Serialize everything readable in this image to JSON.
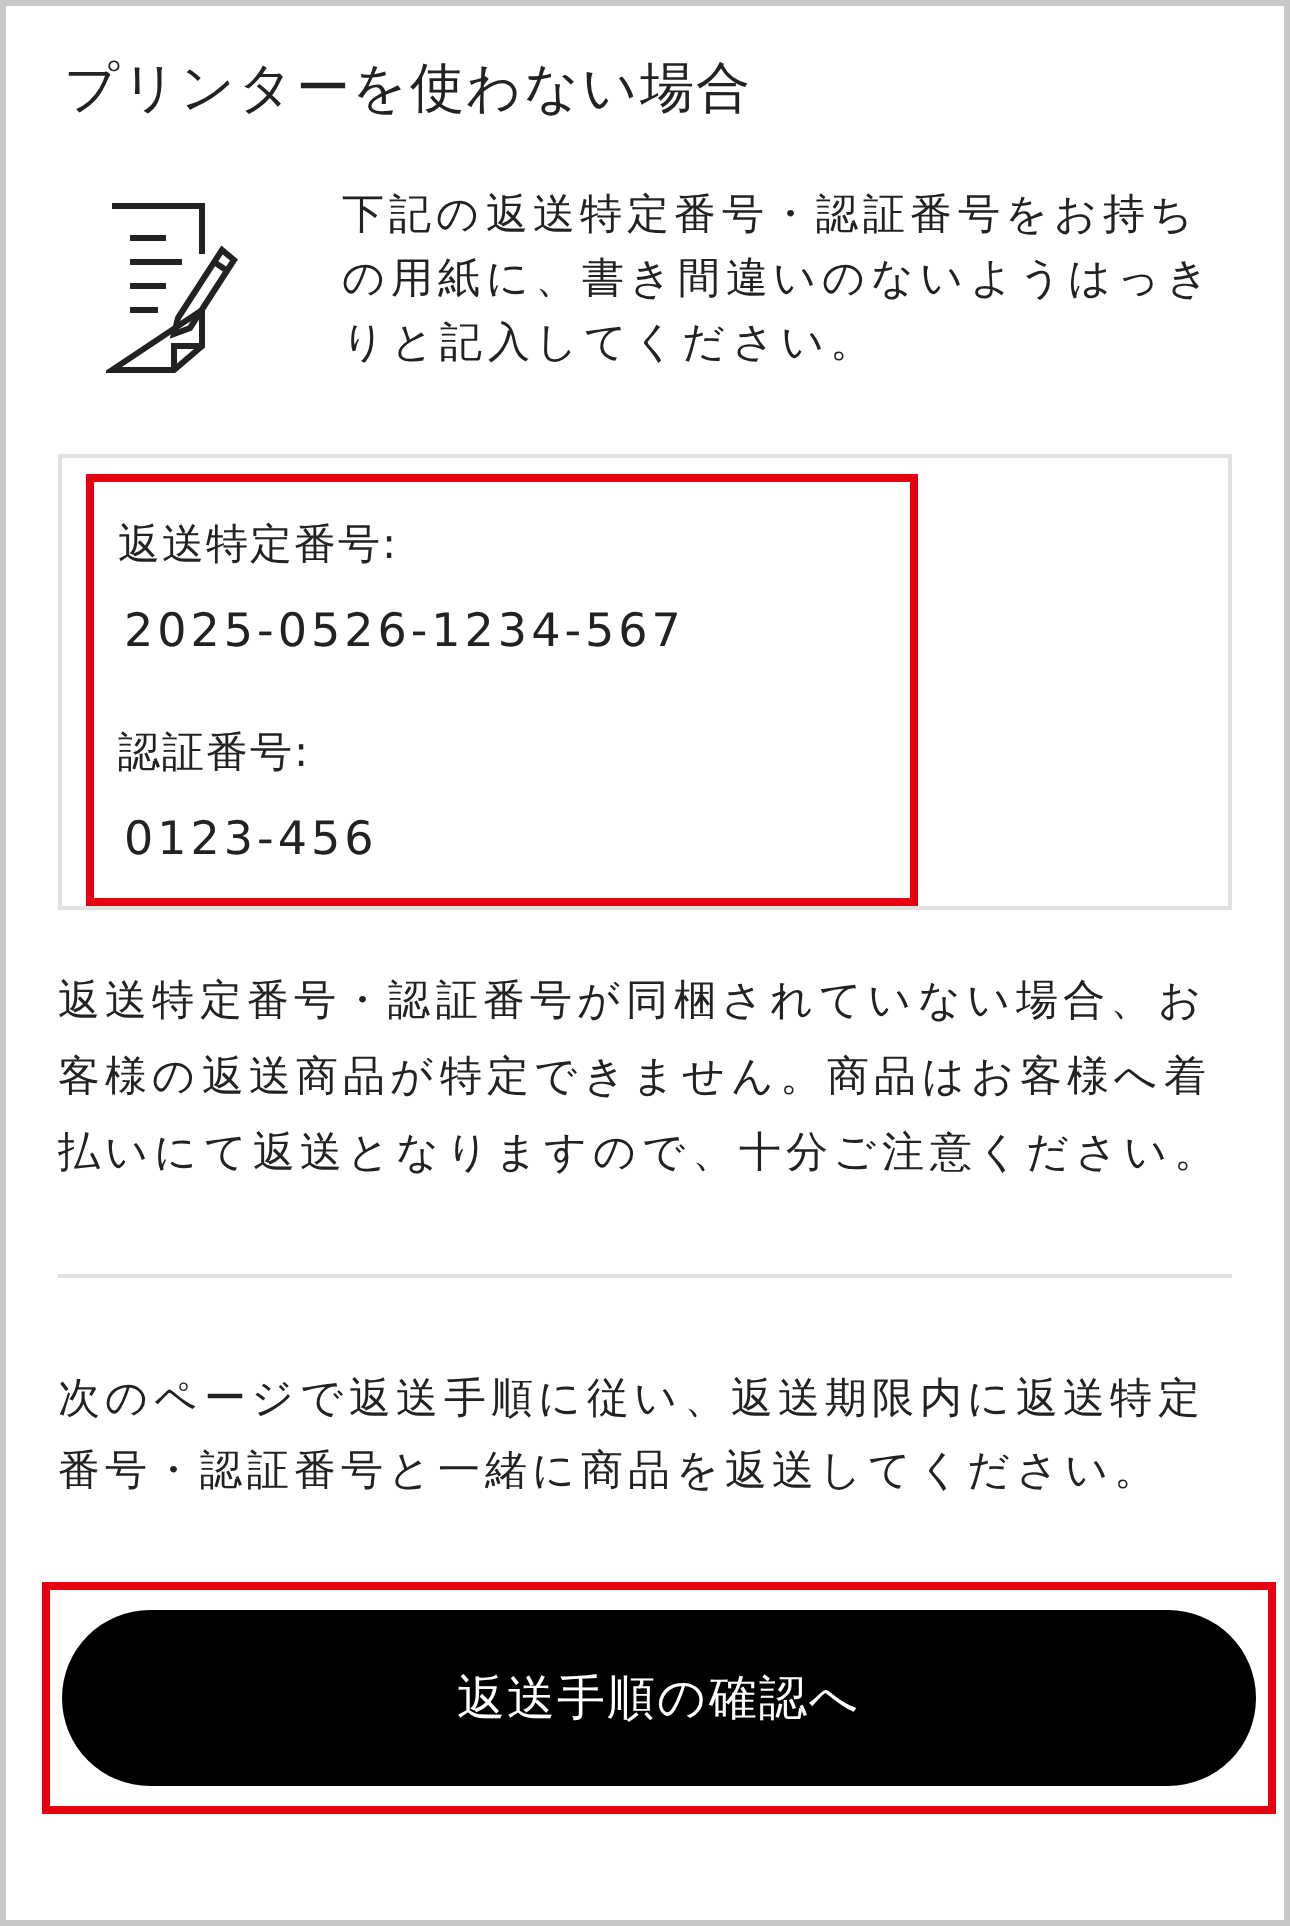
{
  "title": "プリンターを使わない場合",
  "instruction": "下記の返送特定番号・認証番号をお持ちの用紙に、書き間違いのないようはっきりと記入してください。",
  "fields": [
    {
      "label": "返送特定番号:",
      "value": "2025-0526-1234-567"
    },
    {
      "label": "認証番号:",
      "value": "0123-456"
    }
  ],
  "notice": "返送特定番号・認証番号が同梱されていない場合、お客様の返送商品が特定できません。商品はお客様へ着払いにて返送となりますので、十分ご注意ください。",
  "next_instruction": "次のページで返送手順に従い、返送期限内に返送特定番号・認証番号と一緒に商品を返送してください。",
  "button": {
    "label": "返送手順の確認へ"
  }
}
